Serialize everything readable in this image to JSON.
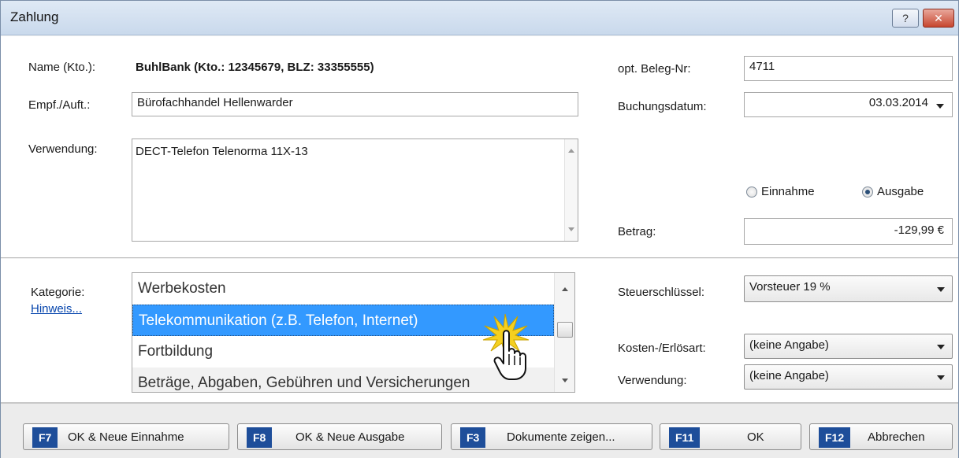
{
  "window": {
    "title": "Zahlung",
    "help_label": "?",
    "close_label": "✕"
  },
  "form": {
    "name_label": "Name (Kto.):",
    "name_value": "BuhlBank (Kto.: 12345679, BLZ: 33355555)",
    "recipient_label": "Empf./Auft.:",
    "recipient_value": "Bürofachhandel Hellenwarder",
    "purpose_label": "Verwendung:",
    "purpose_value": "DECT-Telefon Telenorma 11X-13",
    "receipt_label": "opt. Beleg-Nr:",
    "receipt_value": "4711",
    "date_label": "Buchungsdatum:",
    "date_value": "03.03.2014",
    "income_label": "Einnahme",
    "expense_label": "Ausgabe",
    "selected_type": "Ausgabe",
    "amount_label": "Betrag:",
    "amount_value": "-129,99 €"
  },
  "category": {
    "label": "Kategorie:",
    "hint_link": "Hinweis...",
    "items": [
      "Werbekosten",
      "Telekommunikation (z.B. Telefon, Internet)",
      "Fortbildung",
      "Beträge, Abgaben, Gebühren und Versicherungen"
    ],
    "selected": "Telekommunikation (z.B. Telefon, Internet)"
  },
  "tax": {
    "tax_key_label": "Steuerschlüssel:",
    "tax_key_value": "Vorsteuer 19 %",
    "cost_type_label": "Kosten-/Erlösart:",
    "cost_type_value": "(keine Angabe)",
    "usage_label": "Verwendung:",
    "usage_value": "(keine Angabe)"
  },
  "buttons": [
    {
      "key": "F7",
      "label": "OK & Neue Einnahme"
    },
    {
      "key": "F8",
      "label": "OK & Neue Ausgabe"
    },
    {
      "key": "F3",
      "label": "Dokumente zeigen..."
    },
    {
      "key": "F11",
      "label": "OK"
    },
    {
      "key": "F12",
      "label": "Abbrechen"
    }
  ],
  "colors": {
    "selection": "#3399ff",
    "fkey": "#1e4e9a",
    "titlebar": "#c9d9ec"
  },
  "icons": {
    "cursor": "hand-pointer-icon"
  }
}
